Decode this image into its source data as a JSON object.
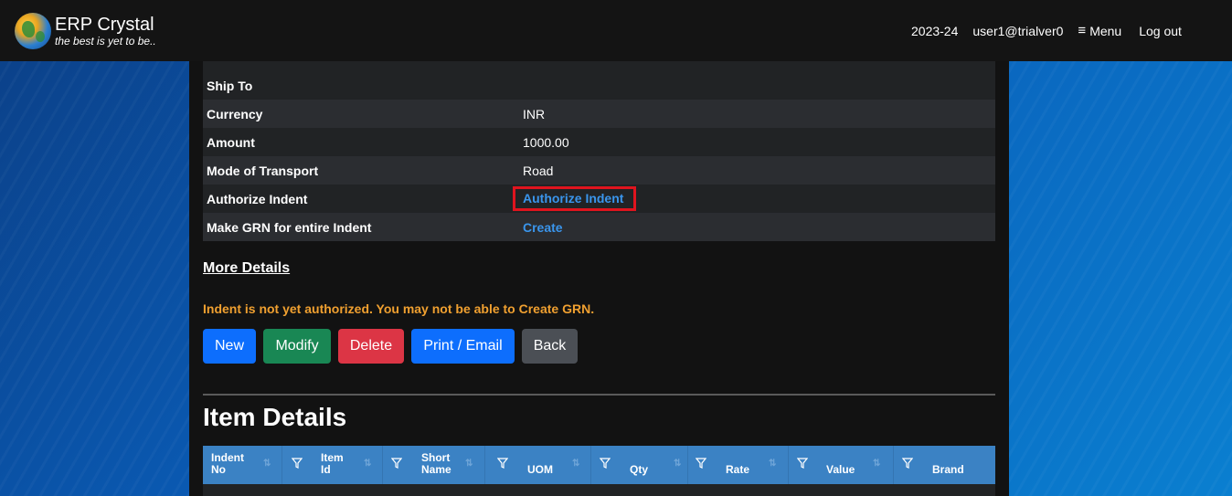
{
  "app": {
    "title": "ERP Crystal",
    "tagline": "the best is yet to be.."
  },
  "nav": {
    "year": "2023-24",
    "user": "user1@trialver0",
    "menu_label": "Menu",
    "logout_label": "Log out"
  },
  "details": {
    "rows": [
      {
        "label": "Ship To",
        "value": ""
      },
      {
        "label": "Currency",
        "value": "INR"
      },
      {
        "label": "Amount",
        "value": "1000.00"
      },
      {
        "label": "Mode of Transport",
        "value": "Road"
      },
      {
        "label": "Authorize Indent",
        "value": "Authorize Indent"
      },
      {
        "label": "Make GRN for entire Indent",
        "value": "Create"
      }
    ]
  },
  "more_details": "More Details",
  "warning": "Indent is not yet authorized. You may not be able to Create GRN.",
  "buttons": {
    "new": "New",
    "modify": "Modify",
    "delete": "Delete",
    "print": "Print / Email",
    "back": "Back"
  },
  "item_details": {
    "heading": "Item Details",
    "columns": [
      {
        "line1": "Indent",
        "line2": "No"
      },
      {
        "line1": "Item",
        "line2": "Id"
      },
      {
        "line1": "Short",
        "line2": "Name"
      },
      {
        "line1": "",
        "line2": "UOM"
      },
      {
        "line1": "",
        "line2": "Qty"
      },
      {
        "line1": "",
        "line2": "Rate"
      },
      {
        "line1": "",
        "line2": "Value"
      },
      {
        "line1": "",
        "line2": "Brand"
      }
    ]
  },
  "colors": {
    "link": "#3a95ec",
    "warning": "#f0a030",
    "highlight_box": "#e0141e",
    "grid_header": "#3b82c4"
  }
}
